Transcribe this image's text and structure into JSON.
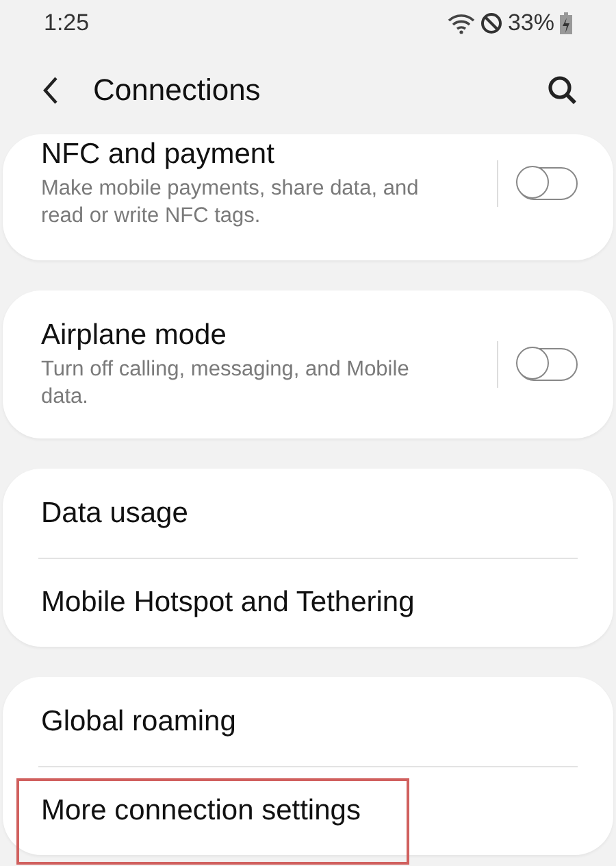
{
  "status_bar": {
    "time": "1:25",
    "battery": "33%"
  },
  "header": {
    "title": "Connections"
  },
  "groups": [
    {
      "items": [
        {
          "kind": "toggle",
          "title": "NFC and payment",
          "subtitle": "Make mobile payments, share data, and read or write NFC tags.",
          "on": false
        }
      ]
    },
    {
      "items": [
        {
          "kind": "toggle",
          "title": "Airplane mode",
          "subtitle": "Turn off calling, messaging, and Mobile data.",
          "on": false
        }
      ]
    },
    {
      "items": [
        {
          "kind": "link",
          "title": "Data usage",
          "highlighted": false
        },
        {
          "kind": "link",
          "title": "Mobile Hotspot and Tethering",
          "highlighted": false
        }
      ]
    },
    {
      "items": [
        {
          "kind": "link",
          "title": "Global roaming",
          "highlighted": false
        },
        {
          "kind": "link",
          "title": "More connection settings",
          "highlighted": true
        }
      ]
    }
  ]
}
